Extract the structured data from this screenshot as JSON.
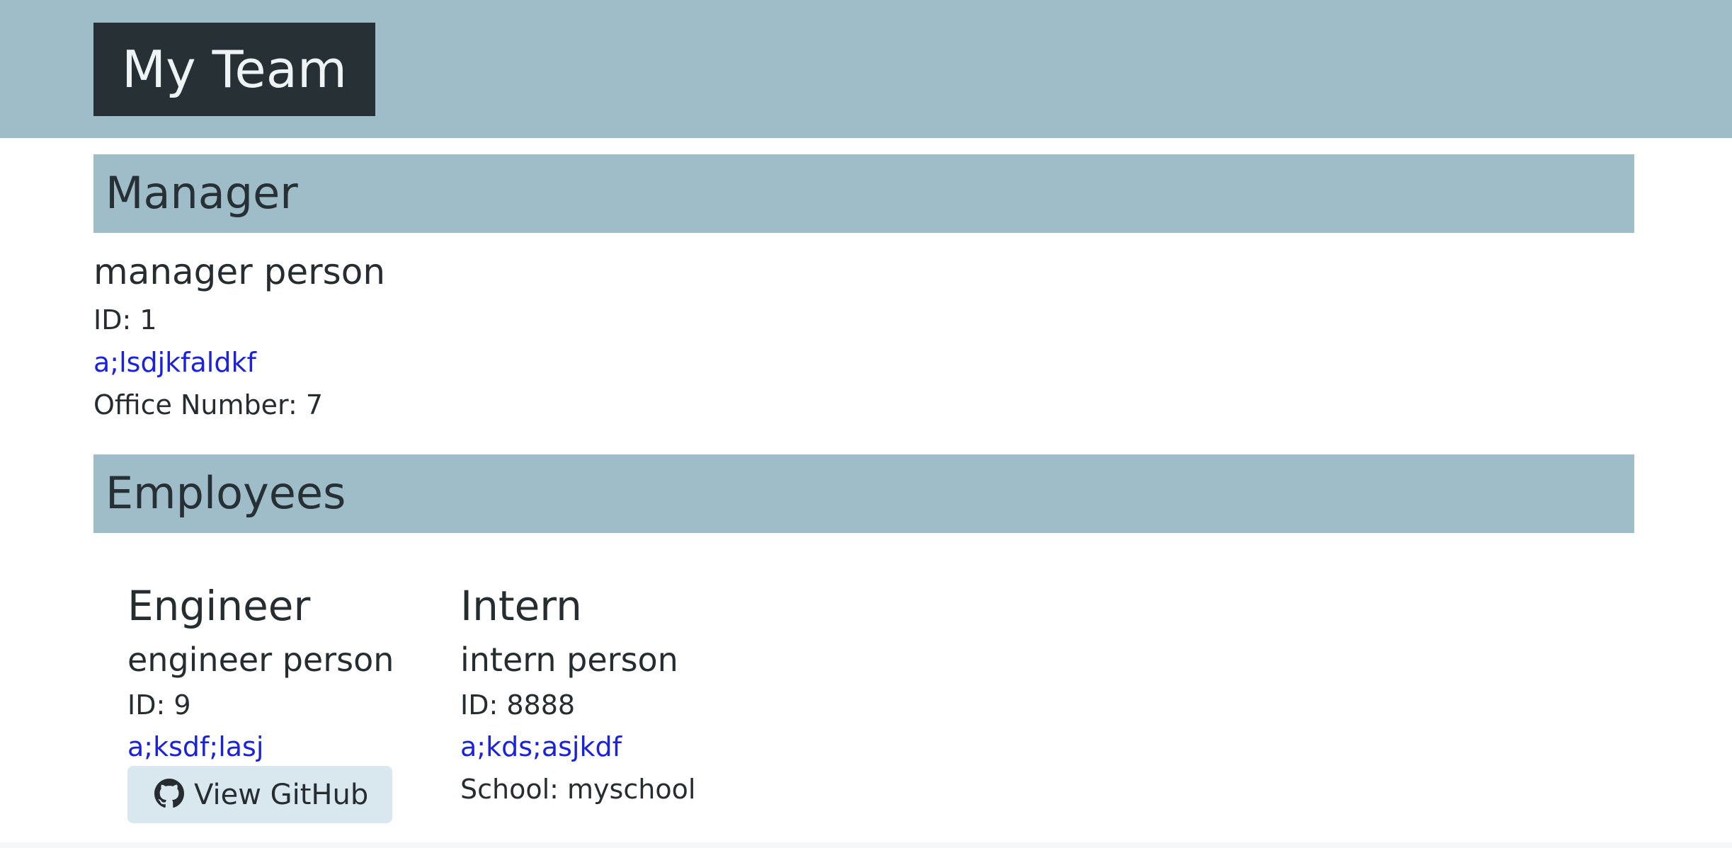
{
  "header": {
    "title": "My Team"
  },
  "manager_section": {
    "heading": "Manager",
    "name": "manager person",
    "id_line": "ID: 1",
    "email": "a;lsdjkfaldkf",
    "office_line": "Office Number: 7"
  },
  "employees_section": {
    "heading": "Employees",
    "engineer": {
      "role": "Engineer",
      "name": "engineer person",
      "id_line": "ID: 9",
      "email": "a;ksdf;lasj",
      "github_button": "View GitHub",
      "github_icon": "github-icon"
    },
    "intern": {
      "role": "Intern",
      "name": "intern person",
      "id_line": "ID: 8888",
      "email": "a;kds;asjkdf",
      "school_line": "School: myschool"
    }
  },
  "colors": {
    "header_bg": "#9fbdc8",
    "logo_bg": "#263035",
    "link": "#1b22dd",
    "button_bg": "#d9e8ee"
  }
}
